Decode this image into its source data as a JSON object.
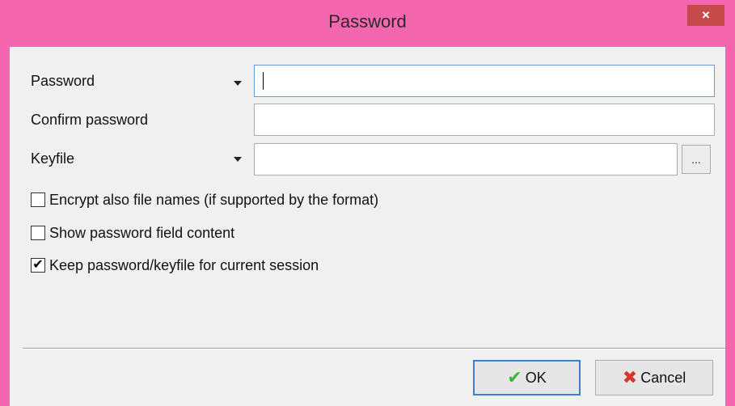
{
  "window": {
    "title": "Password",
    "close_glyph": "×"
  },
  "form": {
    "password_label": "Password",
    "password_value": "",
    "confirm_label": "Confirm password",
    "confirm_value": "",
    "keyfile_label": "Keyfile",
    "keyfile_value": "",
    "browse_label": "..."
  },
  "options": [
    {
      "label": "Encrypt also file names (if supported by the format)",
      "checked": false
    },
    {
      "label": "Show password field content",
      "checked": false
    },
    {
      "label": "Keep password/keyfile for current session",
      "checked": true
    }
  ],
  "buttons": {
    "ok_label": "OK",
    "ok_icon": "check-icon",
    "ok_glyph": "✔",
    "cancel_label": "Cancel",
    "cancel_icon": "x-icon",
    "cancel_glyph": "✖"
  },
  "colors": {
    "titlebar": "#f466ad",
    "close_button": "#c74a4a",
    "ok_icon": "#3db53d",
    "cancel_icon": "#d9342b"
  }
}
